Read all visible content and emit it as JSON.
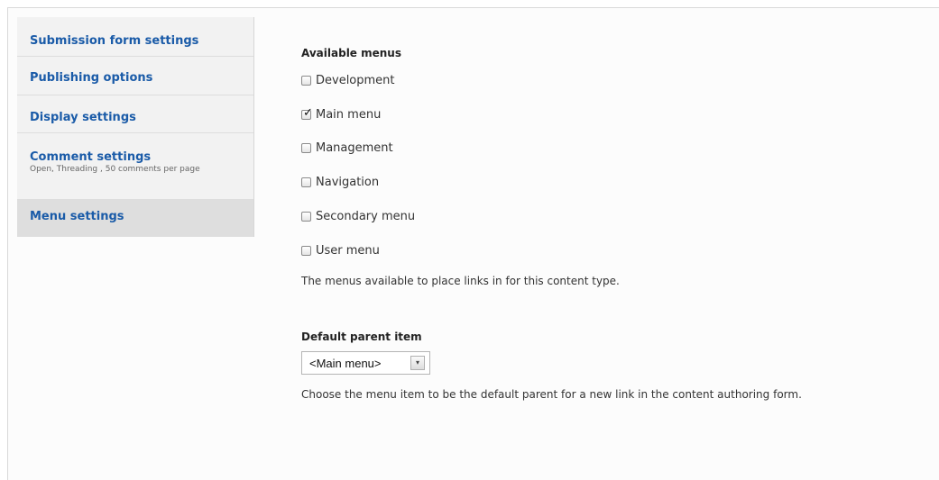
{
  "tabs": [
    {
      "title": "Submission form settings",
      "summary": ""
    },
    {
      "title": "Publishing options",
      "summary": ""
    },
    {
      "title": "Display settings",
      "summary": ""
    },
    {
      "title": "Comment settings",
      "summary": "Open, Threading , 50 comments per page"
    },
    {
      "title": "Menu settings",
      "summary": ""
    }
  ],
  "active_tab": "Menu settings",
  "available_menus": {
    "label": "Available menus",
    "options": [
      {
        "label": "Development",
        "checked": false
      },
      {
        "label": "Main menu",
        "checked": true
      },
      {
        "label": "Management",
        "checked": false
      },
      {
        "label": "Navigation",
        "checked": false
      },
      {
        "label": "Secondary menu",
        "checked": false
      },
      {
        "label": "User menu",
        "checked": false
      }
    ],
    "description": "The menus available to place links in for this content type."
  },
  "default_parent": {
    "label": "Default parent item",
    "selected": "<Main menu>",
    "description": "Choose the menu item to be the default parent for a new link in the content authoring form."
  }
}
